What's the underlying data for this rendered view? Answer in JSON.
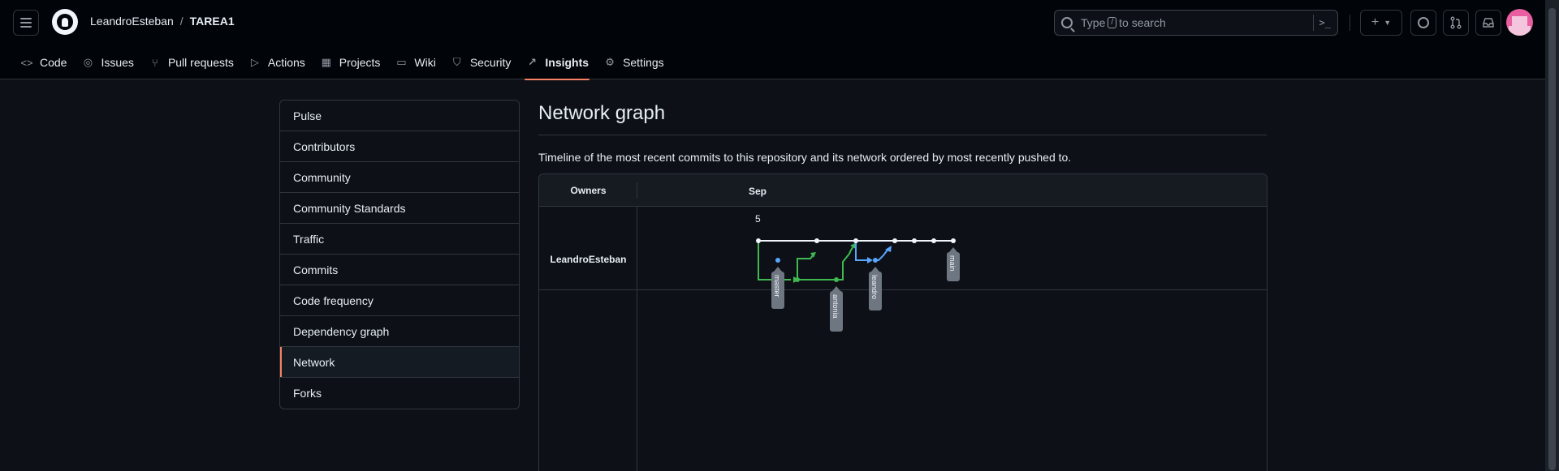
{
  "header": {
    "owner": "LeandroEsteban",
    "separator": "/",
    "repo": "TAREA1",
    "search": {
      "prefix": "Type",
      "key": "/",
      "suffix": "to search"
    }
  },
  "nav": {
    "tabs": [
      {
        "label": "Code",
        "icon": "code-icon"
      },
      {
        "label": "Issues",
        "icon": "issue-icon"
      },
      {
        "label": "Pull requests",
        "icon": "pull-request-icon"
      },
      {
        "label": "Actions",
        "icon": "play-icon"
      },
      {
        "label": "Projects",
        "icon": "table-icon"
      },
      {
        "label": "Wiki",
        "icon": "book-icon"
      },
      {
        "label": "Security",
        "icon": "shield-icon"
      },
      {
        "label": "Insights",
        "icon": "graph-icon"
      },
      {
        "label": "Settings",
        "icon": "gear-icon"
      }
    ]
  },
  "menu": {
    "items": [
      "Pulse",
      "Contributors",
      "Community",
      "Community Standards",
      "Traffic",
      "Commits",
      "Code frequency",
      "Dependency graph",
      "Network",
      "Forks"
    ],
    "selected": "Network"
  },
  "main": {
    "title": "Network graph",
    "description": "Timeline of the most recent commits to this repository and its network ordered by most recently pushed to."
  },
  "graph": {
    "owners_header": "Owners",
    "month": "Sep",
    "day": "5",
    "owner": "LeandroEsteban",
    "branches": [
      "master",
      "antonia",
      "leandro",
      "main"
    ],
    "colors": {
      "main": "#f0f6fc",
      "green": "#3fb950",
      "blue": "#58a6ff",
      "label_bg": "#6e7681"
    }
  }
}
